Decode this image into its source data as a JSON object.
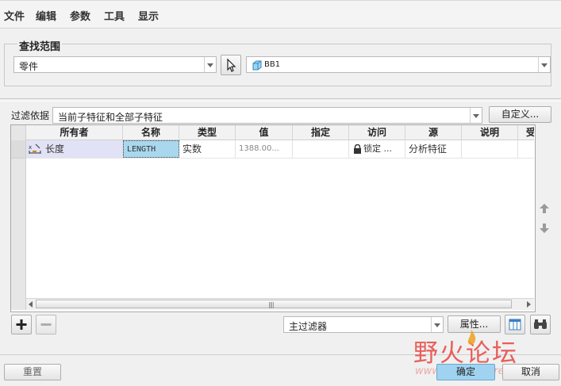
{
  "menu": [
    "文件",
    "编辑",
    "参数",
    "工具",
    "显示"
  ],
  "search_scope": {
    "title": "查找范围",
    "scope_value": "零件",
    "model_value": "BB1"
  },
  "filter": {
    "label": "过滤依据",
    "value": "当前子特征和全部子特征",
    "custom_button": "自定义..."
  },
  "table": {
    "headers": [
      "所有者",
      "名称",
      "类型",
      "值",
      "指定",
      "访问",
      "源",
      "说明",
      "受"
    ],
    "rows": [
      {
        "owner": "长度",
        "name": "LENGTH",
        "type": "实数",
        "value": "1388.00...",
        "designated": "",
        "access": "锁定 ...",
        "source": "分析特征",
        "description": ""
      }
    ]
  },
  "bottom_bar": {
    "filter_value": "主过滤器",
    "properties_button": "属性...",
    "reset_button": "重置",
    "ok_button": "确定",
    "cancel_button": "取消"
  },
  "watermark": {
    "text": "野火论坛",
    "url": "www.proewildfire.cn"
  },
  "colors": {
    "selected_cell": "#a9d8ee",
    "owner_cell": "#e2e2f6",
    "ok_button": "#9fd3f0",
    "watermark": "#e8534f"
  }
}
